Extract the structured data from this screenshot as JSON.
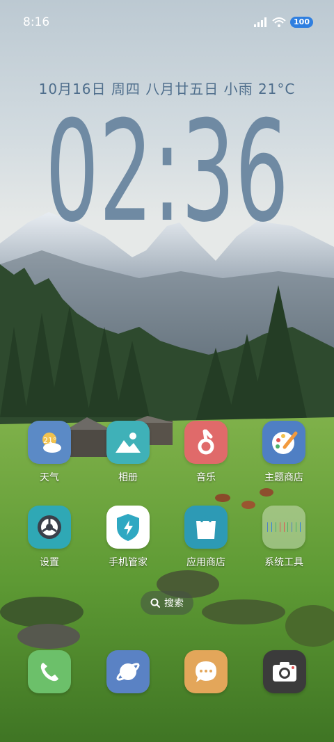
{
  "status": {
    "time": "8:16",
    "battery": "100"
  },
  "lockinfo": {
    "dateline": "10月16日 周四  八月廿五日 小雨  21°C",
    "clock": "02:36"
  },
  "apps": [
    {
      "label": "天气",
      "icon": "weather-icon",
      "badge": "21°",
      "color": "#5b8ac6"
    },
    {
      "label": "相册",
      "icon": "gallery-icon",
      "color": "#3fb1b8"
    },
    {
      "label": "音乐",
      "icon": "music-icon",
      "color": "#e06a6a"
    },
    {
      "label": "主题商店",
      "icon": "theme-store-icon",
      "color": "#4f7fc4"
    },
    {
      "label": "设置",
      "icon": "settings-icon",
      "color": "#2fa8b5"
    },
    {
      "label": "手机管家",
      "icon": "phone-manager-icon",
      "color": "#ffffff"
    },
    {
      "label": "应用商店",
      "icon": "app-store-icon",
      "color": "#2d9ab5"
    },
    {
      "label": "系统工具",
      "icon": "system-tools-folder",
      "color": "#ffffff"
    }
  ],
  "search": {
    "label": "搜索"
  },
  "dock": [
    {
      "name": "phone-icon",
      "color": "#6cc06a"
    },
    {
      "name": "browser-icon",
      "color": "#5a82c4"
    },
    {
      "name": "messages-icon",
      "color": "#e3a65a"
    },
    {
      "name": "camera-icon",
      "color": "#3b3b3b"
    }
  ]
}
